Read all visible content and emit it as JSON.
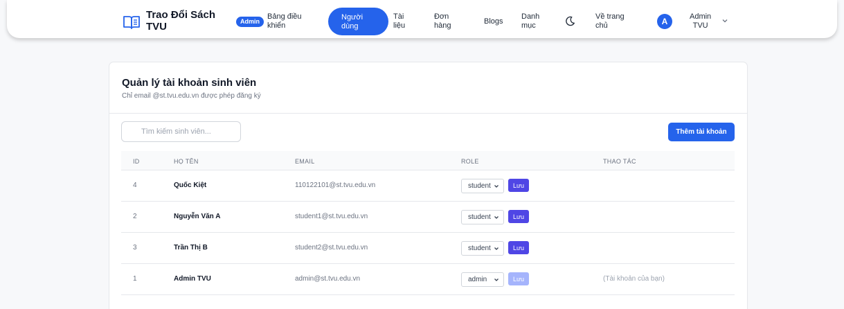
{
  "header": {
    "brand_line1": "Trao Đổi Sách",
    "brand_line2": "TVU",
    "role_badge": "Admin",
    "nav": {
      "dashboard": [
        "Bảng điều",
        "khiển"
      ],
      "users": [
        "Người",
        "dùng"
      ],
      "documents": [
        "Tài",
        "liệu"
      ],
      "orders": [
        "Đơn",
        "hàng"
      ],
      "blogs": "Blogs",
      "categories": [
        "Danh",
        "mục"
      ],
      "home": [
        "Về trang",
        "chủ"
      ]
    },
    "avatar_initial": "A",
    "user_name": [
      "Admin",
      "TVU"
    ],
    "accent_color": "#2563eb"
  },
  "card": {
    "title": "Quản lý tài khoản sinh viên",
    "subtitle": "Chỉ email @st.tvu.edu.vn được phép đăng ký",
    "search_placeholder": "Tìm kiếm sinh viên...",
    "add_button": "Thêm tài khoản",
    "columns": [
      "ID",
      "HỌ TÊN",
      "EMAIL",
      "ROLE",
      "THAO TÁC"
    ],
    "save_label": "Lưu",
    "rows": [
      {
        "id": "4",
        "name": "Quốc Kiệt",
        "email": "110122101@st.tvu.edu.vn",
        "role": "student",
        "note": ""
      },
      {
        "id": "2",
        "name": "Nguyễn Văn A",
        "email": "student1@st.tvu.edu.vn",
        "role": "student",
        "note": ""
      },
      {
        "id": "3",
        "name": "Trần Thị B",
        "email": "student2@st.tvu.edu.vn",
        "role": "student",
        "note": ""
      },
      {
        "id": "1",
        "name": "Admin TVU",
        "email": "admin@st.tvu.edu.vn",
        "role": "admin",
        "note": "(Tài khoản của bạn)"
      }
    ]
  }
}
